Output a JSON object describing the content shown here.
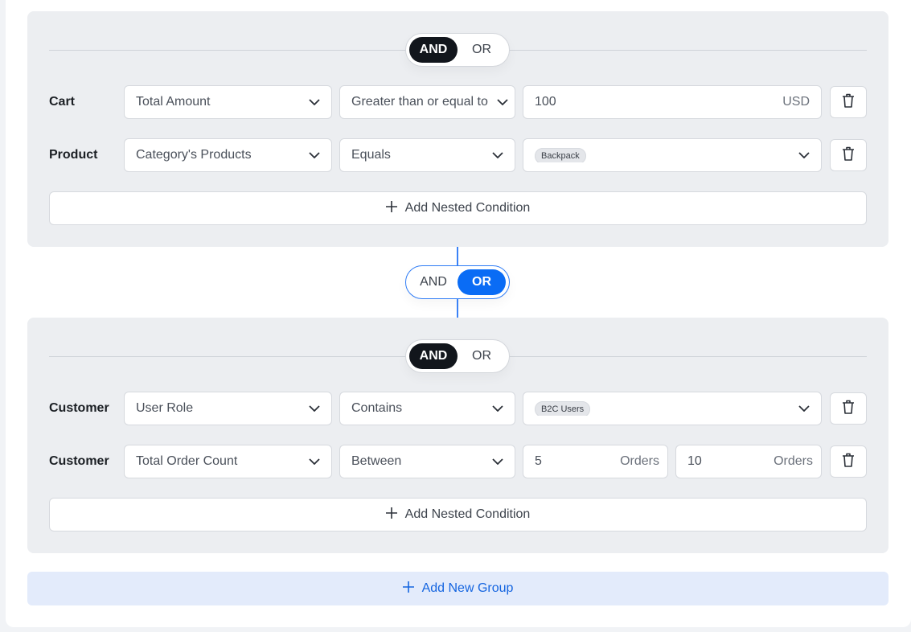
{
  "group_toggle": {
    "and_label": "AND",
    "or_label": "OR"
  },
  "groups_connector": {
    "and_label": "AND",
    "or_label": "OR",
    "selected": "OR"
  },
  "groups": [
    {
      "logic": "AND",
      "conditions": [
        {
          "label": "Cart",
          "field": "Total Amount",
          "operator": "Greater than or equal to",
          "value": "100",
          "unit": "USD"
        },
        {
          "label": "Product",
          "field": "Category's Products",
          "operator": "Equals",
          "value_chip": "Backpack"
        }
      ],
      "add_nested_label": "Add Nested Condition"
    },
    {
      "logic": "AND",
      "conditions": [
        {
          "label": "Customer",
          "field": "User Role",
          "operator": "Contains",
          "value_chip": "B2C Users"
        },
        {
          "label": "Customer",
          "field": "Total Order Count",
          "operator": "Between",
          "min": "5",
          "min_unit": "Orders",
          "max": "10",
          "max_unit": "Orders"
        }
      ],
      "add_nested_label": "Add Nested Condition"
    }
  ],
  "add_group_label": "Add New Group",
  "colors": {
    "accent": "#0a6cf5",
    "dark_toggle": "#12161c",
    "group_bg": "#eceef1"
  }
}
